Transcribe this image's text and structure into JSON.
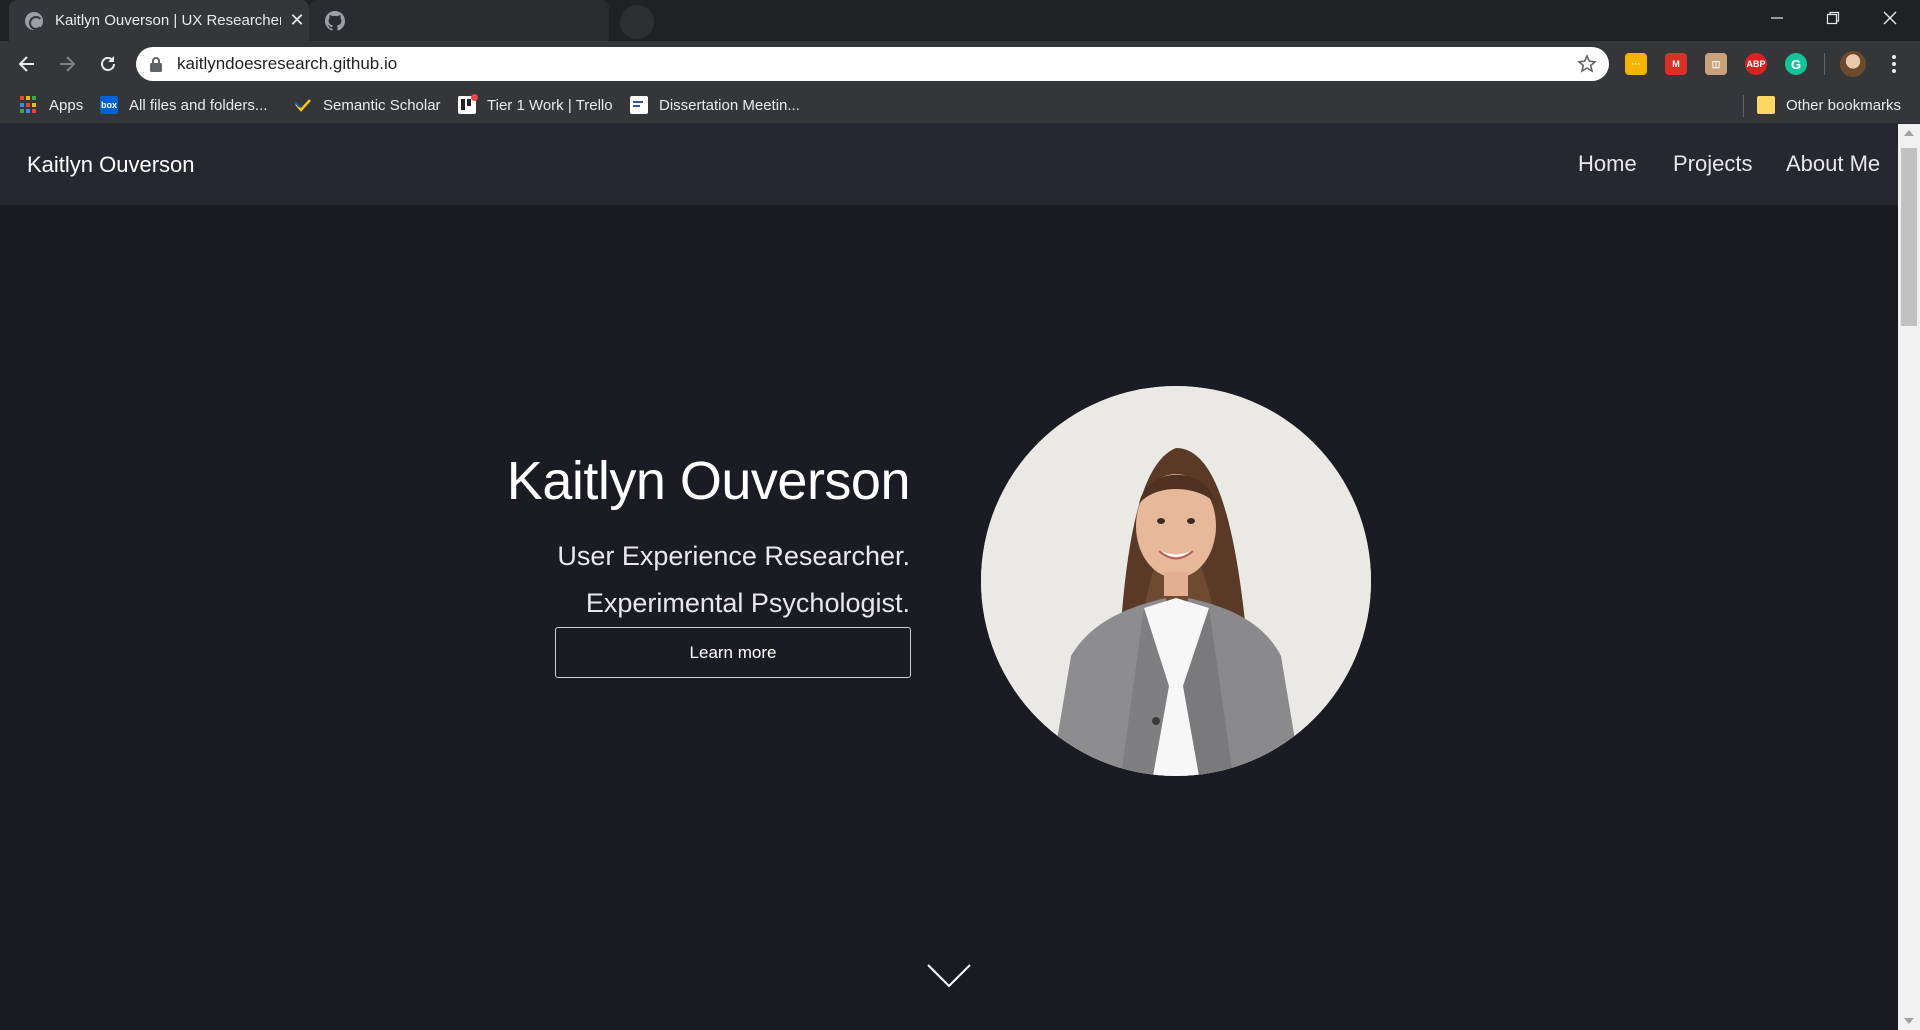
{
  "browser": {
    "tabs": [
      {
        "title": "Kaitlyn Ouverson | UX Researcher",
        "favicon": "globe-icon",
        "active": true
      },
      {
        "title": "",
        "favicon": "github-icon",
        "active": false
      }
    ],
    "address_bar": {
      "url": "kaitlyndoesresearch.github.io"
    },
    "extensions": [
      {
        "name": "yellow-extension-icon",
        "color": "#f4b400"
      },
      {
        "name": "mendeley-icon",
        "color": "#d93025"
      },
      {
        "name": "character-extension-icon",
        "color": "#c8a27a"
      },
      {
        "name": "adblock-plus-icon",
        "color": "#e02020",
        "text": "ABP"
      },
      {
        "name": "grammarly-icon",
        "color": "#15c39a",
        "text": "G"
      }
    ],
    "bookmarks": [
      {
        "label": "Apps",
        "icon": "apps-grid-icon"
      },
      {
        "label": "All files and folders...",
        "icon": "box-icon"
      },
      {
        "label": "Semantic Scholar",
        "icon": "semantic-scholar-icon"
      },
      {
        "label": "Tier 1 Work | Trello",
        "icon": "trello-icon"
      },
      {
        "label": "Dissertation Meetin...",
        "icon": "notes-icon"
      }
    ],
    "other_bookmarks": "Other bookmarks"
  },
  "site": {
    "brand": "Kaitlyn Ouverson",
    "nav": [
      "Home",
      "Projects",
      "About Me"
    ],
    "hero": {
      "name": "Kaitlyn Ouverson",
      "line1": "User Experience Researcher.",
      "line2": "Experimental Psychologist.",
      "button": "Learn more"
    }
  },
  "colors": {
    "page_bg": "#1b1c23",
    "nav_bg": "#262731",
    "chrome_bg": "#35363a",
    "text": "#ffffff"
  }
}
